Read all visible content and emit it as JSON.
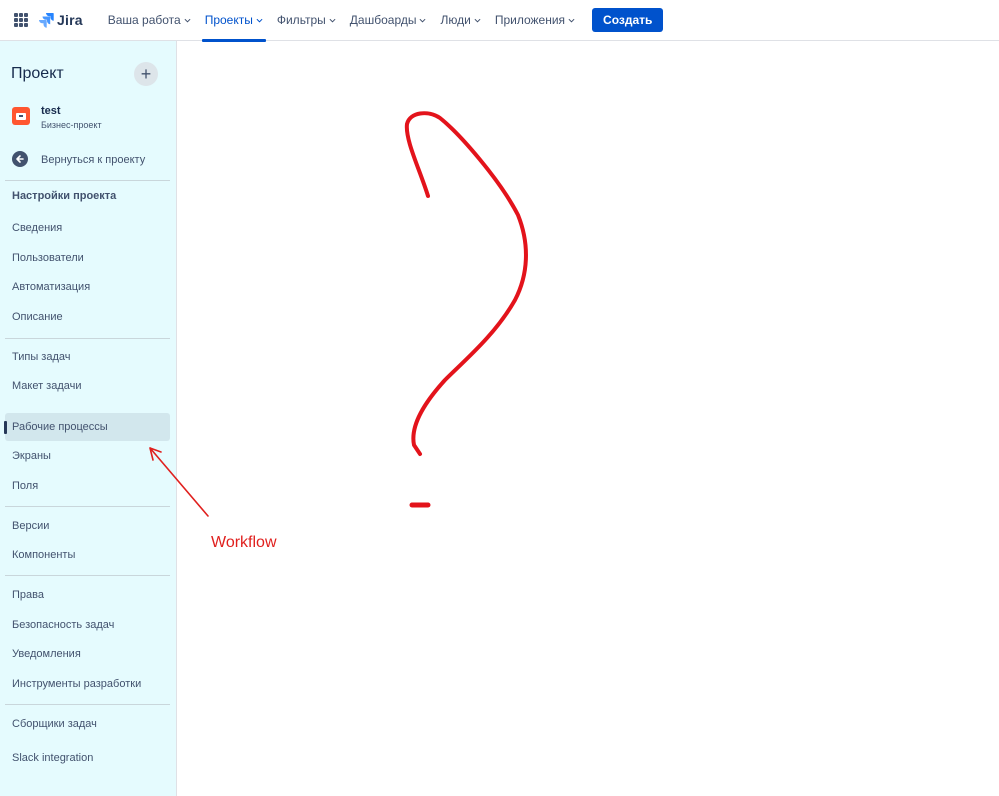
{
  "topnav": {
    "logo_text": "Jira",
    "items": [
      {
        "label": "Ваша работа"
      },
      {
        "label": "Проекты"
      },
      {
        "label": "Фильтры"
      },
      {
        "label": "Дашбоарды"
      },
      {
        "label": "Люди"
      },
      {
        "label": "Приложения"
      }
    ],
    "active_item": "Проекты",
    "create_label": "Создать",
    "accent_color": "#0052cc"
  },
  "sidebar": {
    "header": "Проект",
    "project": {
      "name": "test",
      "type": "Бизнес-проект",
      "avatar_color": "#ff5630"
    },
    "back_label": "Вернуться к проекту",
    "section_title": "Настройки проекта",
    "items": [
      {
        "label": "Сведения"
      },
      {
        "label": "Пользователи"
      },
      {
        "label": "Автоматизация"
      },
      {
        "label": "Описание"
      },
      {
        "label": "Типы задач"
      },
      {
        "label": "Макет задачи"
      },
      {
        "label": "Рабочие процессы"
      },
      {
        "label": "Экраны"
      },
      {
        "label": "Поля"
      },
      {
        "label": "Версии"
      },
      {
        "label": "Компоненты"
      },
      {
        "label": "Права"
      },
      {
        "label": "Безопасность задач"
      },
      {
        "label": "Уведомления"
      },
      {
        "label": "Инструменты разработки"
      },
      {
        "label": "Сборщики задач"
      },
      {
        "label": "Slack integration"
      }
    ],
    "selected_item": "Рабочие процессы",
    "background_color": "#e5fbfe"
  },
  "annotations": {
    "label": "Workflow",
    "color": "#e0201e",
    "question_mark_icon": "question-mark-drawing",
    "arrow_icon": "arrow-annotation"
  }
}
